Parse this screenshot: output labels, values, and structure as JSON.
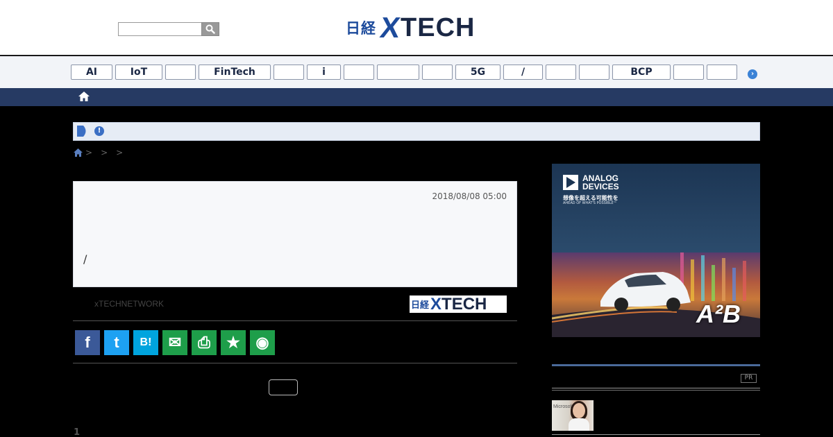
{
  "header": {
    "search_placeholder": "",
    "logo_prefix": "日経",
    "logo_x": "X",
    "logo_text": "TECH"
  },
  "tags": [
    {
      "label": "AI"
    },
    {
      "label": "IoT"
    },
    {
      "label": ""
    },
    {
      "label": "FinTech"
    },
    {
      "label": ""
    },
    {
      "label": "i"
    },
    {
      "label": ""
    },
    {
      "label": ""
    },
    {
      "label": ""
    },
    {
      "label": "5G"
    },
    {
      "label": "/"
    },
    {
      "label": ""
    },
    {
      "label": ""
    },
    {
      "label": "BCP"
    },
    {
      "label": ""
    },
    {
      "label": ""
    }
  ],
  "tag_next_glyph": "›",
  "notice": {
    "info_glyph": "!"
  },
  "breadcrumb": {
    "separators": [
      ">",
      ">",
      ">"
    ]
  },
  "article": {
    "date": "2018/08/08 05:00",
    "title": "/"
  },
  "author": {
    "name": "xTECHNETWORK",
    "logo_prefix": "日経",
    "logo_x": "X",
    "logo_text": "TECH"
  },
  "share": [
    {
      "name": "facebook",
      "glyph": "f",
      "color": "#3b5998"
    },
    {
      "name": "twitter",
      "glyph": "t",
      "color": "#1da1f2"
    },
    {
      "name": "hatena",
      "glyph": "B!",
      "color": "#00a4de"
    },
    {
      "name": "mail",
      "glyph": "✉",
      "color": "#1e9e4a"
    },
    {
      "name": "print",
      "glyph": "⎙",
      "color": "#1e9e4a"
    },
    {
      "name": "bookmark",
      "glyph": "★",
      "color": "#1e9e4a"
    },
    {
      "name": "watch",
      "glyph": "◉",
      "color": "#1e9e4a"
    }
  ],
  "pager": {
    "page": "1"
  },
  "ad": {
    "brand_line1": "ANALOG",
    "brand_line2": "DEVICES",
    "tagline_jp": "想像を超える可能性を",
    "tagline_en": "AHEAD OF WHAT'S POSSIBLE™",
    "product": "A²B"
  },
  "sidebar": {
    "pr_label": "PR",
    "thumb_caption": "Microsoft"
  },
  "colors": {
    "navy": "#263a63",
    "brand_blue": "#1d4b9c",
    "share_green": "#1e9e4a"
  }
}
